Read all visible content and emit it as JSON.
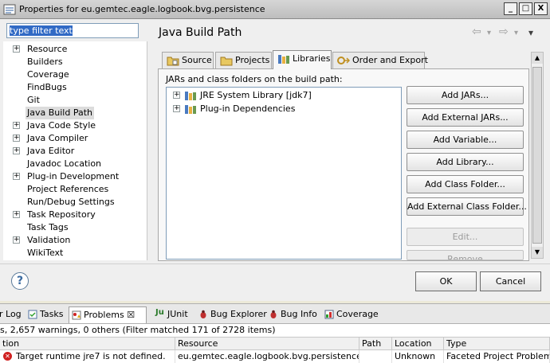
{
  "window": {
    "title": "Properties for eu.gemtec.eagle.logbook.bvg.persistence",
    "minimize": "_",
    "maximize": "□",
    "close": "X"
  },
  "filter": {
    "value": "type filter text"
  },
  "tree": {
    "items": [
      {
        "label": "Resource",
        "expandable": true
      },
      {
        "label": "Builders",
        "expandable": false
      },
      {
        "label": "Coverage",
        "expandable": false
      },
      {
        "label": "FindBugs",
        "expandable": false
      },
      {
        "label": "Git",
        "expandable": false
      },
      {
        "label": "Java Build Path",
        "expandable": false,
        "selected": true
      },
      {
        "label": "Java Code Style",
        "expandable": true
      },
      {
        "label": "Java Compiler",
        "expandable": true
      },
      {
        "label": "Java Editor",
        "expandable": true
      },
      {
        "label": "Javadoc Location",
        "expandable": false
      },
      {
        "label": "Plug-in Development",
        "expandable": true
      },
      {
        "label": "Project References",
        "expandable": false
      },
      {
        "label": "Run/Debug Settings",
        "expandable": false
      },
      {
        "label": "Task Repository",
        "expandable": true
      },
      {
        "label": "Task Tags",
        "expandable": false
      },
      {
        "label": "Validation",
        "expandable": true
      },
      {
        "label": "WikiText",
        "expandable": false
      }
    ]
  },
  "page": {
    "title": "Java Build Path",
    "nav": {
      "back": "⇦",
      "back_drop": "▾",
      "forward": "⇨",
      "forward_drop": "▾",
      "menu": "▾"
    }
  },
  "tabs": [
    {
      "label": "Source",
      "active": false
    },
    {
      "label": "Projects",
      "active": false
    },
    {
      "label": "Libraries",
      "active": true
    },
    {
      "label": "Order and Export",
      "active": false
    }
  ],
  "libraries": {
    "heading": "JARs and class folders on the build path:",
    "entries": [
      "JRE System Library [jdk7]",
      "Plug-in Dependencies"
    ],
    "buttons": [
      {
        "label": "Add JARs...",
        "enabled": true
      },
      {
        "label": "Add External JARs...",
        "enabled": true
      },
      {
        "label": "Add Variable...",
        "enabled": true
      },
      {
        "label": "Add Library...",
        "enabled": true
      },
      {
        "label": "Add Class Folder...",
        "enabled": true
      },
      {
        "label": "Add External Class Folder...",
        "enabled": true
      },
      {
        "label": "Edit...",
        "enabled": false
      },
      {
        "label": "Remove",
        "enabled": false
      }
    ]
  },
  "dialog": {
    "help": "?",
    "ok": "OK",
    "cancel": "Cancel"
  },
  "views": {
    "tabs": [
      {
        "label": "r Log",
        "active": false
      },
      {
        "label": "Tasks",
        "active": false
      },
      {
        "label": "Problems ☒",
        "active": true
      },
      {
        "label": "JUnit",
        "active": false
      },
      {
        "label": "Bug Explorer",
        "active": false
      },
      {
        "label": "Bug Info",
        "active": false
      },
      {
        "label": "Coverage",
        "active": false
      }
    ]
  },
  "problems": {
    "summary": "s, 2,657 warnings, 0 others (Filter matched 171 of 2728 items)",
    "columns": [
      "tion",
      "Resource",
      "Path",
      "Location",
      "Type"
    ],
    "rows": [
      {
        "description": "Target runtime jre7 is not defined.",
        "resource": "eu.gemtec.eagle.logbook.bvg.persistence",
        "path": "",
        "location": "Unknown",
        "type": "Faceted Project Problem"
      }
    ]
  },
  "colors": {
    "selection": "#316ac5",
    "error": "#d02020",
    "tree_selected": "#dcdcdc"
  }
}
